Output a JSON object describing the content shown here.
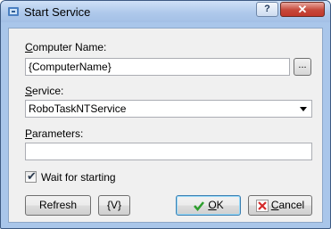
{
  "window": {
    "title": "Start Service"
  },
  "titlebar": {
    "help_label": "?",
    "close_label": "✕"
  },
  "form": {
    "computer_name": {
      "label_u": "C",
      "label_rest": "omputer Name:",
      "value": "{ComputerName}",
      "browse_label": "..."
    },
    "service": {
      "label_u": "S",
      "label_rest": "ervice:",
      "value": "RoboTaskNTService"
    },
    "parameters": {
      "label_u": "P",
      "label_rest": "arameters:",
      "value": ""
    },
    "wait_for_starting": {
      "label": "Wait for starting",
      "checked": true
    }
  },
  "buttons": {
    "refresh": "Refresh",
    "variables": "{V}",
    "ok_u": "O",
    "ok_rest": "K",
    "cancel_u": "C",
    "cancel_rest": "ancel"
  },
  "colors": {
    "ok_icon": "#2e9e2e",
    "cancel_icon": "#d42b2b",
    "title_accent": "#a9c6ea"
  }
}
